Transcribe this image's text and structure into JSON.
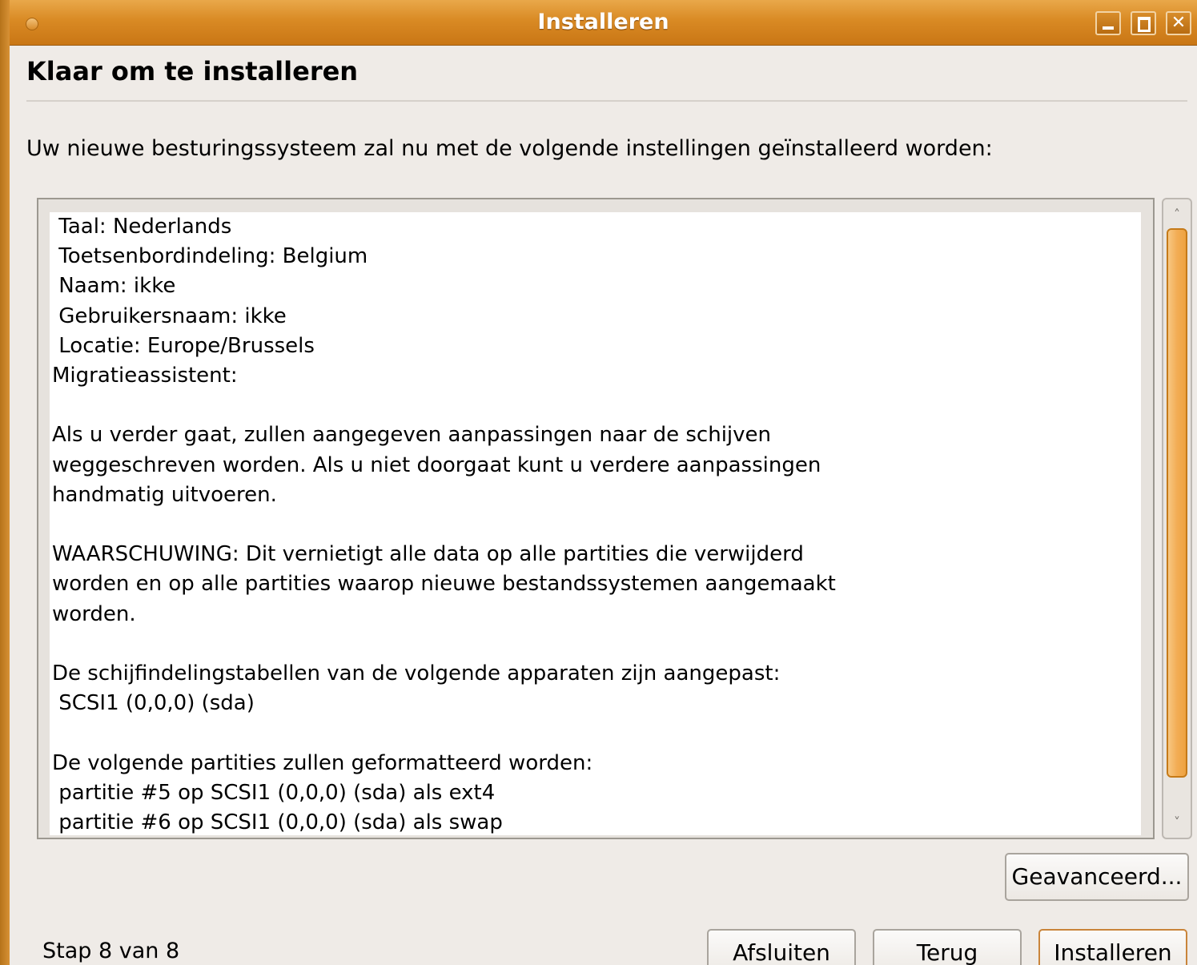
{
  "window": {
    "title": "Installeren",
    "buttons": {
      "minimize": "minimize-icon",
      "maximize": "maximize-icon",
      "close": "close-icon"
    }
  },
  "page": {
    "heading": "Klaar om te installeren",
    "intro": "Uw nieuwe besturingssysteem zal nu met de volgende instellingen geïnstalleerd worden:"
  },
  "summary": {
    "text": " Taal: Nederlands\n Toetsenbordindeling: Belgium\n Naam: ikke\n Gebruikersnaam: ikke\n Locatie: Europe/Brussels\nMigratieassistent:\n\nAls u verder gaat, zullen aangegeven aanpassingen naar de schijven\nweggeschreven worden. Als u niet doorgaat kunt u verdere aanpassingen\nhandmatig uitvoeren.\n\nWAARSCHUWING: Dit vernietigt alle data op alle partities die verwijderd\nworden en op alle partities waarop nieuwe bestandssystemen aangemaakt\nworden.\n\nDe schijfindelingstabellen van de volgende apparaten zijn aangepast:\n SCSI1 (0,0,0) (sda)\n\nDe volgende partities zullen geformatteerd worden:\n partitie #5 op SCSI1 (0,0,0) (sda) als ext4\n partitie #6 op SCSI1 (0,0,0) (sda) als swap"
  },
  "scrollbar": {
    "up_icon": "˄",
    "down_icon": "˅"
  },
  "buttons": {
    "advanced": "Geavanceerd...",
    "quit": "Afsluiten",
    "back": "Terug",
    "install": "Installeren"
  },
  "footer": {
    "step": "Stap 8 van 8"
  },
  "colors": {
    "titlebar": "#d98a24",
    "desktop": "#c8851c",
    "dialog_bg": "#efebe7",
    "scroll_thumb": "#f2ad55"
  }
}
